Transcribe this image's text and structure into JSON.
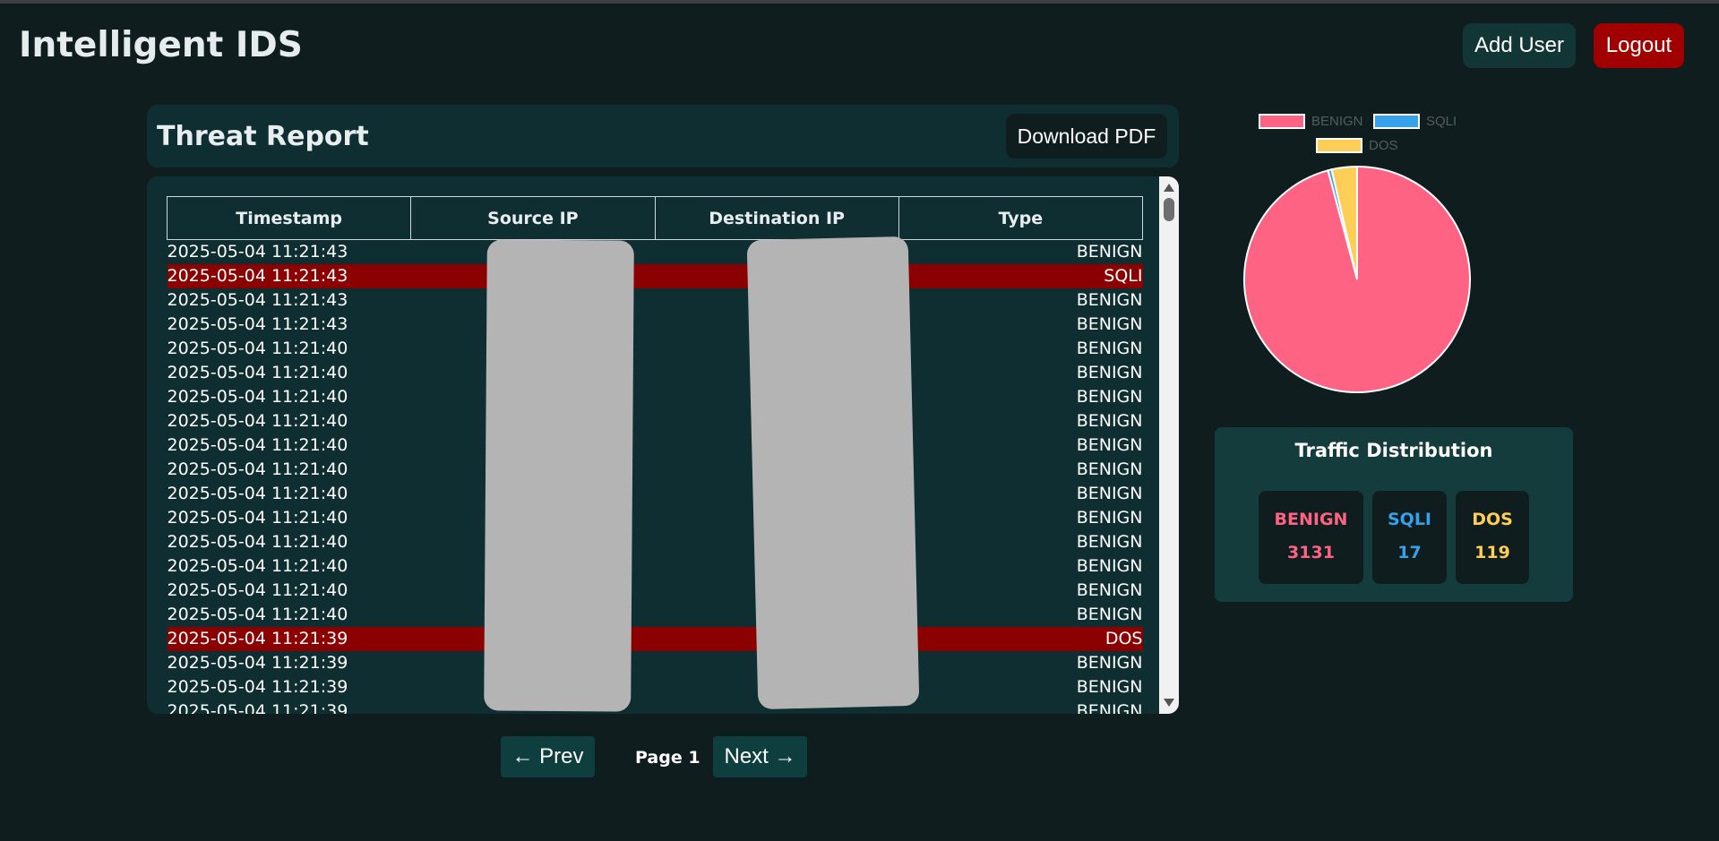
{
  "app": {
    "title": "Intelligent IDS"
  },
  "header": {
    "add_user_label": "Add User",
    "logout_label": "Logout"
  },
  "report": {
    "title": "Threat Report",
    "download_label": "Download PDF"
  },
  "table": {
    "columns": [
      "Timestamp",
      "Source IP",
      "Destination IP",
      "Type"
    ],
    "rows": [
      {
        "timestamp": "2025-05-04 11:21:43",
        "type": "BENIGN"
      },
      {
        "timestamp": "2025-05-04 11:21:43",
        "type": "SQLI"
      },
      {
        "timestamp": "2025-05-04 11:21:43",
        "type": "BENIGN"
      },
      {
        "timestamp": "2025-05-04 11:21:43",
        "type": "BENIGN"
      },
      {
        "timestamp": "2025-05-04 11:21:40",
        "type": "BENIGN"
      },
      {
        "timestamp": "2025-05-04 11:21:40",
        "type": "BENIGN"
      },
      {
        "timestamp": "2025-05-04 11:21:40",
        "type": "BENIGN"
      },
      {
        "timestamp": "2025-05-04 11:21:40",
        "type": "BENIGN"
      },
      {
        "timestamp": "2025-05-04 11:21:40",
        "type": "BENIGN"
      },
      {
        "timestamp": "2025-05-04 11:21:40",
        "type": "BENIGN"
      },
      {
        "timestamp": "2025-05-04 11:21:40",
        "type": "BENIGN"
      },
      {
        "timestamp": "2025-05-04 11:21:40",
        "type": "BENIGN"
      },
      {
        "timestamp": "2025-05-04 11:21:40",
        "type": "BENIGN"
      },
      {
        "timestamp": "2025-05-04 11:21:40",
        "type": "BENIGN"
      },
      {
        "timestamp": "2025-05-04 11:21:40",
        "type": "BENIGN"
      },
      {
        "timestamp": "2025-05-04 11:21:40",
        "type": "BENIGN"
      },
      {
        "timestamp": "2025-05-04 11:21:39",
        "type": "DOS"
      },
      {
        "timestamp": "2025-05-04 11:21:39",
        "type": "BENIGN"
      },
      {
        "timestamp": "2025-05-04 11:21:39",
        "type": "BENIGN"
      },
      {
        "timestamp": "2025-05-04 11:21:39",
        "type": "BENIGN"
      }
    ]
  },
  "pagination": {
    "prev_label": "← Prev",
    "page_label": "Page 1",
    "next_label": "Next →"
  },
  "distribution": {
    "title": "Traffic Distribution",
    "stats": [
      {
        "label": "BENIGN",
        "value": "3131",
        "color": "#ff6384"
      },
      {
        "label": "SQLI",
        "value": "17",
        "color": "#36a2eb"
      },
      {
        "label": "DOS",
        "value": "119",
        "color": "#ffce56"
      }
    ]
  },
  "chart_data": {
    "type": "pie",
    "categories": [
      "BENIGN",
      "SQLI",
      "DOS"
    ],
    "values": [
      3131,
      17,
      119
    ],
    "colors": [
      "#ff6384",
      "#36a2eb",
      "#ffce56"
    ],
    "legend": "top"
  },
  "colors": {
    "alert_row": "#8b0000",
    "logout": "#a10000",
    "panel": "#0e2e31",
    "background": "#0f1d1f"
  }
}
